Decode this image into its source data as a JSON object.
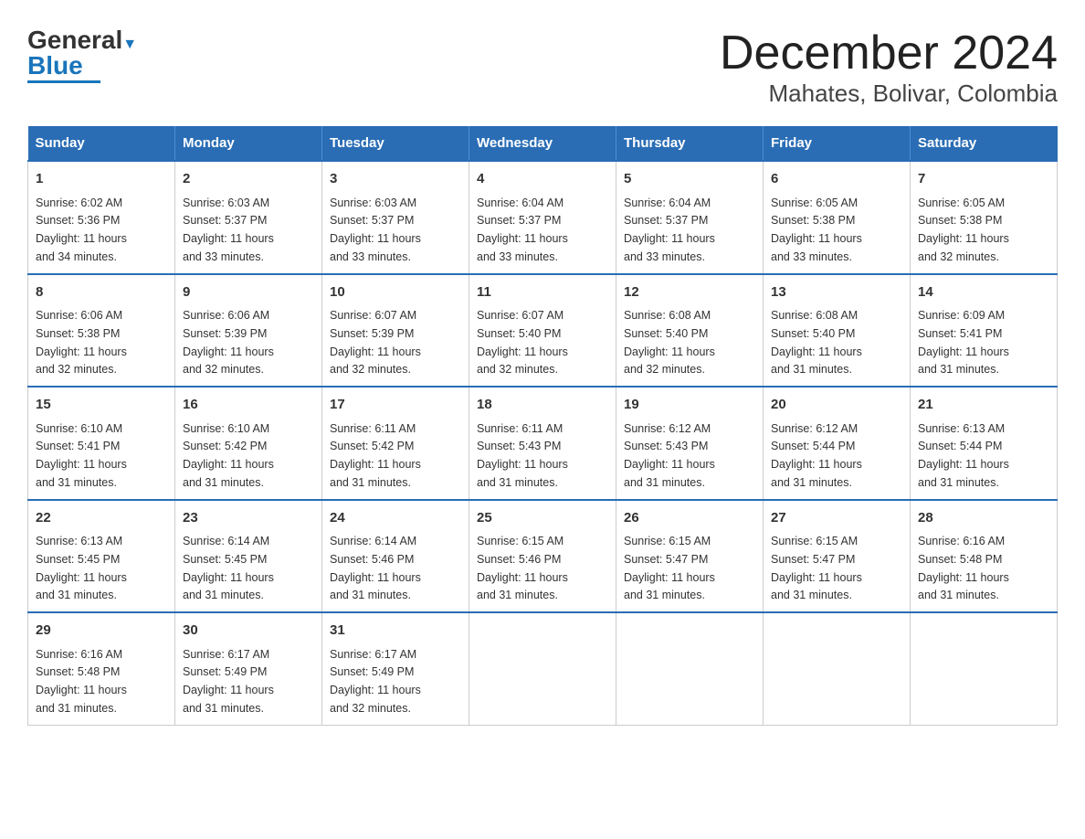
{
  "logo": {
    "text_general": "General",
    "text_blue": "Blue"
  },
  "title": "December 2024",
  "subtitle": "Mahates, Bolivar, Colombia",
  "days_of_week": [
    "Sunday",
    "Monday",
    "Tuesday",
    "Wednesday",
    "Thursday",
    "Friday",
    "Saturday"
  ],
  "weeks": [
    [
      {
        "day": "1",
        "sunrise": "6:02 AM",
        "sunset": "5:36 PM",
        "daylight": "11 hours and 34 minutes."
      },
      {
        "day": "2",
        "sunrise": "6:03 AM",
        "sunset": "5:37 PM",
        "daylight": "11 hours and 33 minutes."
      },
      {
        "day": "3",
        "sunrise": "6:03 AM",
        "sunset": "5:37 PM",
        "daylight": "11 hours and 33 minutes."
      },
      {
        "day": "4",
        "sunrise": "6:04 AM",
        "sunset": "5:37 PM",
        "daylight": "11 hours and 33 minutes."
      },
      {
        "day": "5",
        "sunrise": "6:04 AM",
        "sunset": "5:37 PM",
        "daylight": "11 hours and 33 minutes."
      },
      {
        "day": "6",
        "sunrise": "6:05 AM",
        "sunset": "5:38 PM",
        "daylight": "11 hours and 33 minutes."
      },
      {
        "day": "7",
        "sunrise": "6:05 AM",
        "sunset": "5:38 PM",
        "daylight": "11 hours and 32 minutes."
      }
    ],
    [
      {
        "day": "8",
        "sunrise": "6:06 AM",
        "sunset": "5:38 PM",
        "daylight": "11 hours and 32 minutes."
      },
      {
        "day": "9",
        "sunrise": "6:06 AM",
        "sunset": "5:39 PM",
        "daylight": "11 hours and 32 minutes."
      },
      {
        "day": "10",
        "sunrise": "6:07 AM",
        "sunset": "5:39 PM",
        "daylight": "11 hours and 32 minutes."
      },
      {
        "day": "11",
        "sunrise": "6:07 AM",
        "sunset": "5:40 PM",
        "daylight": "11 hours and 32 minutes."
      },
      {
        "day": "12",
        "sunrise": "6:08 AM",
        "sunset": "5:40 PM",
        "daylight": "11 hours and 32 minutes."
      },
      {
        "day": "13",
        "sunrise": "6:08 AM",
        "sunset": "5:40 PM",
        "daylight": "11 hours and 31 minutes."
      },
      {
        "day": "14",
        "sunrise": "6:09 AM",
        "sunset": "5:41 PM",
        "daylight": "11 hours and 31 minutes."
      }
    ],
    [
      {
        "day": "15",
        "sunrise": "6:10 AM",
        "sunset": "5:41 PM",
        "daylight": "11 hours and 31 minutes."
      },
      {
        "day": "16",
        "sunrise": "6:10 AM",
        "sunset": "5:42 PM",
        "daylight": "11 hours and 31 minutes."
      },
      {
        "day": "17",
        "sunrise": "6:11 AM",
        "sunset": "5:42 PM",
        "daylight": "11 hours and 31 minutes."
      },
      {
        "day": "18",
        "sunrise": "6:11 AM",
        "sunset": "5:43 PM",
        "daylight": "11 hours and 31 minutes."
      },
      {
        "day": "19",
        "sunrise": "6:12 AM",
        "sunset": "5:43 PM",
        "daylight": "11 hours and 31 minutes."
      },
      {
        "day": "20",
        "sunrise": "6:12 AM",
        "sunset": "5:44 PM",
        "daylight": "11 hours and 31 minutes."
      },
      {
        "day": "21",
        "sunrise": "6:13 AM",
        "sunset": "5:44 PM",
        "daylight": "11 hours and 31 minutes."
      }
    ],
    [
      {
        "day": "22",
        "sunrise": "6:13 AM",
        "sunset": "5:45 PM",
        "daylight": "11 hours and 31 minutes."
      },
      {
        "day": "23",
        "sunrise": "6:14 AM",
        "sunset": "5:45 PM",
        "daylight": "11 hours and 31 minutes."
      },
      {
        "day": "24",
        "sunrise": "6:14 AM",
        "sunset": "5:46 PM",
        "daylight": "11 hours and 31 minutes."
      },
      {
        "day": "25",
        "sunrise": "6:15 AM",
        "sunset": "5:46 PM",
        "daylight": "11 hours and 31 minutes."
      },
      {
        "day": "26",
        "sunrise": "6:15 AM",
        "sunset": "5:47 PM",
        "daylight": "11 hours and 31 minutes."
      },
      {
        "day": "27",
        "sunrise": "6:15 AM",
        "sunset": "5:47 PM",
        "daylight": "11 hours and 31 minutes."
      },
      {
        "day": "28",
        "sunrise": "6:16 AM",
        "sunset": "5:48 PM",
        "daylight": "11 hours and 31 minutes."
      }
    ],
    [
      {
        "day": "29",
        "sunrise": "6:16 AM",
        "sunset": "5:48 PM",
        "daylight": "11 hours and 31 minutes."
      },
      {
        "day": "30",
        "sunrise": "6:17 AM",
        "sunset": "5:49 PM",
        "daylight": "11 hours and 31 minutes."
      },
      {
        "day": "31",
        "sunrise": "6:17 AM",
        "sunset": "5:49 PM",
        "daylight": "11 hours and 32 minutes."
      },
      null,
      null,
      null,
      null
    ]
  ],
  "labels": {
    "sunrise": "Sunrise:",
    "sunset": "Sunset:",
    "daylight": "Daylight:"
  }
}
